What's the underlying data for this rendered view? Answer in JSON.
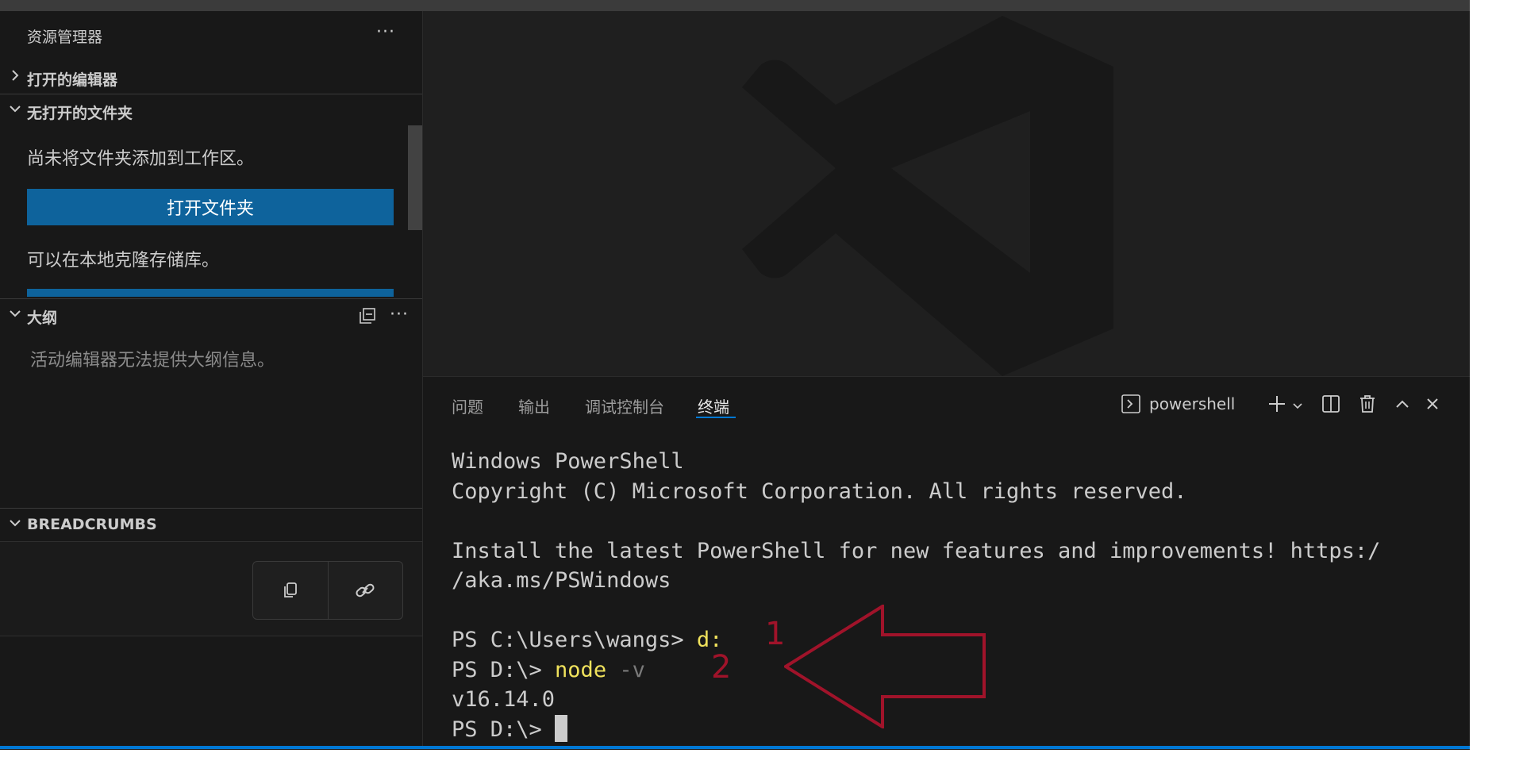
{
  "sidebar": {
    "title": "资源管理器",
    "more_label": "···",
    "sections": {
      "open_editors": "打开的编辑器",
      "no_folder": "无打开的文件夹",
      "outline": "大纲",
      "breadcrumbs": "BREADCRUMBS"
    },
    "no_folder_text": "尚未将文件夹添加到工作区。",
    "open_folder_button": "打开文件夹",
    "clone_text": "可以在本地克隆存储库。",
    "outline_empty": "活动编辑器无法提供大纲信息。",
    "outline_more": "···"
  },
  "panel": {
    "tabs": [
      {
        "label": "问题"
      },
      {
        "label": "输出"
      },
      {
        "label": "调试控制台"
      },
      {
        "label": "终端"
      }
    ],
    "active_tab": "终端",
    "shell_name": "powershell"
  },
  "terminal": {
    "line1": "Windows PowerShell",
    "line2": "Copyright (C) Microsoft Corporation. All rights reserved.",
    "line3": "Install the latest PowerShell for new features and improvements! https:/",
    "line4": "/aka.ms/PSWindows",
    "prompt1": "PS C:\\Users\\wangs> ",
    "cmd1": "d:",
    "prompt2": "PS D:\\> ",
    "cmd2": "node",
    "cmd2_arg": " -v",
    "output": "v16.14.0",
    "prompt3": "PS D:\\> "
  },
  "annotations": {
    "step1": "1",
    "step2": "2",
    "color": "#a0132a"
  },
  "colors": {
    "accent": "#0078d4",
    "button": "#0e639c",
    "terminal_yellow": "#f0e25c"
  }
}
